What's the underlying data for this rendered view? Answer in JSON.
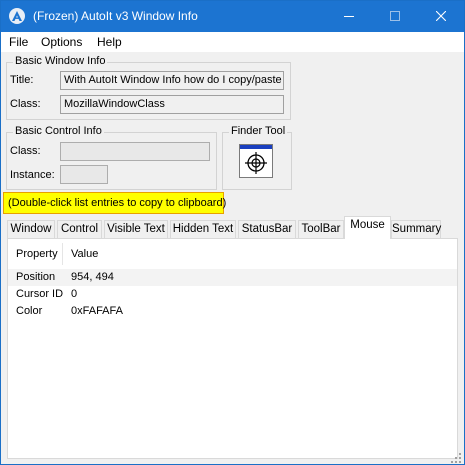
{
  "window": {
    "title": "(Frozen) AutoIt v3 Window Info",
    "accent_color": "#1c74d1"
  },
  "menu": [
    "File",
    "Options",
    "Help"
  ],
  "basic_window_info": {
    "legend": "Basic Window Info",
    "title_label": "Title:",
    "title_value": "With AutoIt Window Info how do I copy/paste",
    "class_label": "Class:",
    "class_value": "MozillaWindowClass"
  },
  "basic_control_info": {
    "legend": "Basic Control Info",
    "class_label": "Class:",
    "class_value": "",
    "instance_label": "Instance:",
    "instance_value": ""
  },
  "finder_tool": {
    "legend": "Finder Tool",
    "icon": "crosshair-target-icon"
  },
  "hint": "(Double-click list entries to copy to clipboard)",
  "tabs": [
    {
      "label": "Window"
    },
    {
      "label": "Control"
    },
    {
      "label": "Visible Text"
    },
    {
      "label": "Hidden Text"
    },
    {
      "label": "StatusBar"
    },
    {
      "label": "ToolBar"
    },
    {
      "label": "Mouse"
    },
    {
      "label": "Summary"
    }
  ],
  "active_tab": "Mouse",
  "list": {
    "columns": [
      "Property",
      "Value"
    ],
    "rows": [
      {
        "property": "Position",
        "value": "954, 494"
      },
      {
        "property": "Cursor ID",
        "value": "0"
      },
      {
        "property": "Color",
        "value": "0xFAFAFA"
      }
    ]
  }
}
